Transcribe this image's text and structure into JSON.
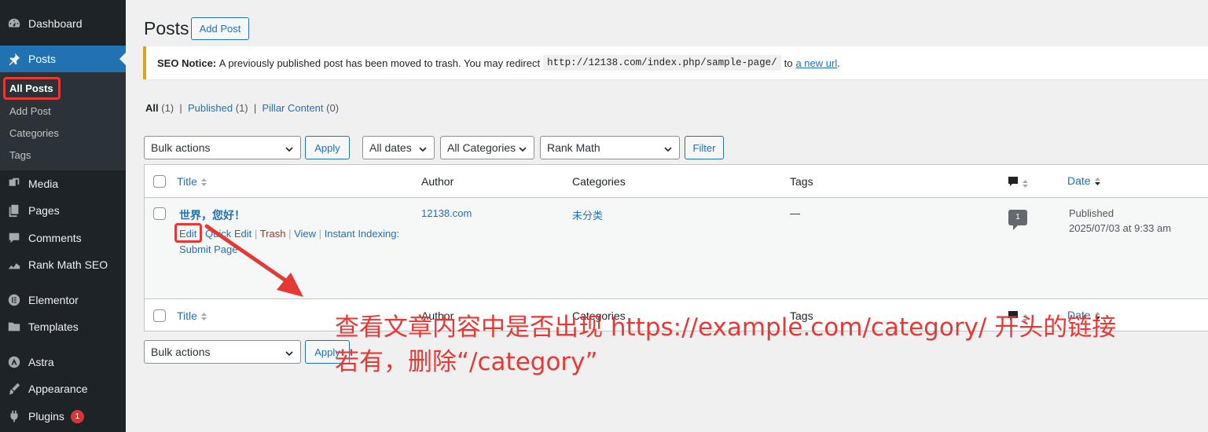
{
  "sidebar": {
    "items": [
      {
        "label": "Dashboard",
        "icon": "dashboard-icon"
      },
      {
        "label": "Posts",
        "icon": "pin-icon"
      },
      {
        "label": "Media",
        "icon": "media-icon"
      },
      {
        "label": "Pages",
        "icon": "pages-icon"
      },
      {
        "label": "Comments",
        "icon": "comments-icon"
      },
      {
        "label": "Rank Math SEO",
        "icon": "chart-icon"
      },
      {
        "label": "Elementor",
        "icon": "elementor-icon"
      },
      {
        "label": "Templates",
        "icon": "folder-icon"
      },
      {
        "label": "Astra",
        "icon": "astra-icon"
      },
      {
        "label": "Appearance",
        "icon": "brush-icon"
      },
      {
        "label": "Plugins",
        "icon": "plugin-icon",
        "badge": "1"
      }
    ],
    "submenu": [
      "All Posts",
      "Add Post",
      "Categories",
      "Tags"
    ],
    "accent": "#2271b1"
  },
  "header": {
    "title": "Posts",
    "add_label": "Add Post"
  },
  "notice": {
    "strong": "SEO Notice:",
    "text": "A previously published post has been moved to trash. You may redirect",
    "code": "http://12138.com/index.php/sample-page/",
    "to": "to",
    "link": "a new url",
    "end": "."
  },
  "filters": {
    "all": "All",
    "all_count": "(1)",
    "published": "Published",
    "published_count": "(1)",
    "pillar": "Pillar Content",
    "pillar_count": "(0)",
    "sep": "|"
  },
  "toolbar": {
    "bulk": "Bulk actions",
    "apply": "Apply",
    "dates": "All dates",
    "categories": "All Categories",
    "rankmath": "Rank Math",
    "filter": "Filter"
  },
  "table": {
    "columns": {
      "title": "Title",
      "author": "Author",
      "categories": "Categories",
      "tags": "Tags",
      "date": "Date"
    },
    "row": {
      "title": "世界，您好！",
      "actions": {
        "edit": "Edit",
        "quick_edit": "Quick Edit",
        "trash": "Trash",
        "view": "View",
        "instant": "Instant Indexing: Submit Page"
      },
      "author": "12138.com",
      "category": "未分类",
      "tags": "—",
      "comments": "1",
      "status": "Published",
      "date": "2025/07/03 at 9:33 am"
    }
  },
  "annotation": {
    "line1": "查看文章内容中是否出现 https://example.com/category/ 开头的链接",
    "line2": "若有，删除“/category”",
    "color": "#e53935"
  }
}
